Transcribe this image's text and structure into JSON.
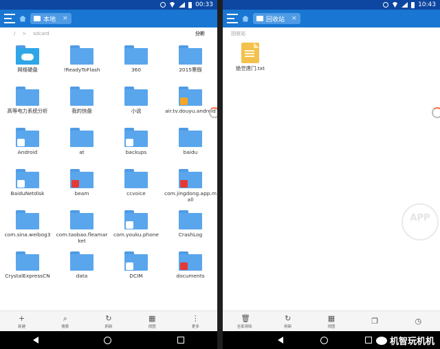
{
  "left": {
    "status_time": "00:33",
    "tab_label": "本地",
    "tab_close": "×",
    "path": {
      "root": "/",
      "sep": ">",
      "current": "sdcard",
      "action": "分析"
    },
    "items": [
      {
        "label": "网络硬盘",
        "kind": "cloud",
        "badge": "cloud"
      },
      {
        "label": "!ReadyToFlash",
        "kind": "folder"
      },
      {
        "label": "360",
        "kind": "folder"
      },
      {
        "label": "2015寒假",
        "kind": "folder"
      },
      {
        "label": "高等电力系统分析",
        "kind": "folder"
      },
      {
        "label": "我的快盘",
        "kind": "folder"
      },
      {
        "label": "小说",
        "kind": "folder"
      },
      {
        "label": "air.tv.douyu.android",
        "kind": "folder",
        "badge": "douyu"
      },
      {
        "label": "Android",
        "kind": "folder",
        "badge": "gear"
      },
      {
        "label": "at",
        "kind": "folder"
      },
      {
        "label": "backups",
        "kind": "folder",
        "badge": "backups"
      },
      {
        "label": "baidu",
        "kind": "folder"
      },
      {
        "label": "BaiduNetdisk",
        "kind": "folder",
        "badge": "baidu"
      },
      {
        "label": "beam",
        "kind": "folder",
        "badge": "wps"
      },
      {
        "label": "ccvoice",
        "kind": "folder"
      },
      {
        "label": "com.jingdong.app.mall",
        "kind": "folder",
        "badge": "jd"
      },
      {
        "label": "com.sina.weibog3",
        "kind": "folder"
      },
      {
        "label": "com.taobao.fleamarket",
        "kind": "folder"
      },
      {
        "label": "com.youku.phone",
        "kind": "folder",
        "badge": "youku"
      },
      {
        "label": "CrashLog",
        "kind": "folder"
      },
      {
        "label": "CrystalExpressCN",
        "kind": "folder"
      },
      {
        "label": "data",
        "kind": "folder"
      },
      {
        "label": "DCIM",
        "kind": "folder",
        "badge": "camera"
      },
      {
        "label": "documents",
        "kind": "folder",
        "badge": "wps"
      }
    ],
    "bottom_actions": [
      {
        "icon": "plus-icon",
        "glyph": "+",
        "label": "新建"
      },
      {
        "icon": "search-icon",
        "glyph": "⌕",
        "label": "搜索"
      },
      {
        "icon": "refresh-icon",
        "glyph": "↻",
        "label": "刷新"
      },
      {
        "icon": "view-icon",
        "glyph": "▦",
        "label": "视图"
      },
      {
        "icon": "more-icon",
        "glyph": "⋮",
        "label": "更多"
      }
    ]
  },
  "right": {
    "status_time": "10:43",
    "tab_label": "回收站",
    "tab_close": "×",
    "path_label": "回收站",
    "file_label": "绝世唐门.txt",
    "bottom_actions": [
      {
        "icon": "trash-icon",
        "glyph": "🗑",
        "label": "全部清除"
      },
      {
        "icon": "refresh-icon",
        "glyph": "↻",
        "label": "刷新"
      },
      {
        "icon": "view-icon",
        "glyph": "▦",
        "label": "视图"
      },
      {
        "icon": "windows-icon",
        "glyph": "❐",
        "label": ""
      },
      {
        "icon": "history-icon",
        "glyph": "◷",
        "label": ""
      }
    ]
  },
  "watermark": "APP",
  "wechat_label": "机智玩机机",
  "colors": {
    "toolbar": "#1976d2",
    "statusbar": "#0d47a1",
    "folder": "#5aa6ec",
    "txt_file": "#f3c14d"
  }
}
